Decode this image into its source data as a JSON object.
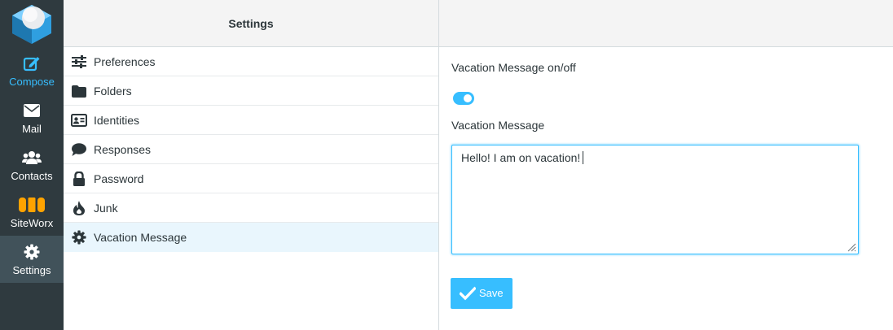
{
  "nav": {
    "items": [
      {
        "label": "Compose",
        "icon": "compose-icon"
      },
      {
        "label": "Mail",
        "icon": "mail-icon"
      },
      {
        "label": "Contacts",
        "icon": "contacts-icon"
      },
      {
        "label": "SiteWorx",
        "icon": "siteworx-icon"
      },
      {
        "label": "Settings",
        "icon": "gear-icon",
        "active": true
      }
    ]
  },
  "settings_pane": {
    "title": "Settings",
    "items": [
      {
        "label": "Preferences",
        "icon": "sliders-icon"
      },
      {
        "label": "Folders",
        "icon": "folder-icon"
      },
      {
        "label": "Identities",
        "icon": "id-card-icon"
      },
      {
        "label": "Responses",
        "icon": "speech-bubble-icon"
      },
      {
        "label": "Password",
        "icon": "lock-icon"
      },
      {
        "label": "Junk",
        "icon": "flame-icon"
      },
      {
        "label": "Vacation Message",
        "icon": "gear-icon",
        "selected": true
      }
    ]
  },
  "vacation": {
    "toggle_label": "Vacation Message on/off",
    "toggle_on": true,
    "message_label": "Vacation Message",
    "message_value": "Hello! I am on vacation!",
    "save_label": "Save"
  },
  "colors": {
    "accent": "#37beff",
    "sidebar": "#2f3a3f",
    "sidebar_active": "#41525a",
    "selected_row": "#e9f6fd",
    "siteworx": "#ffa300"
  }
}
